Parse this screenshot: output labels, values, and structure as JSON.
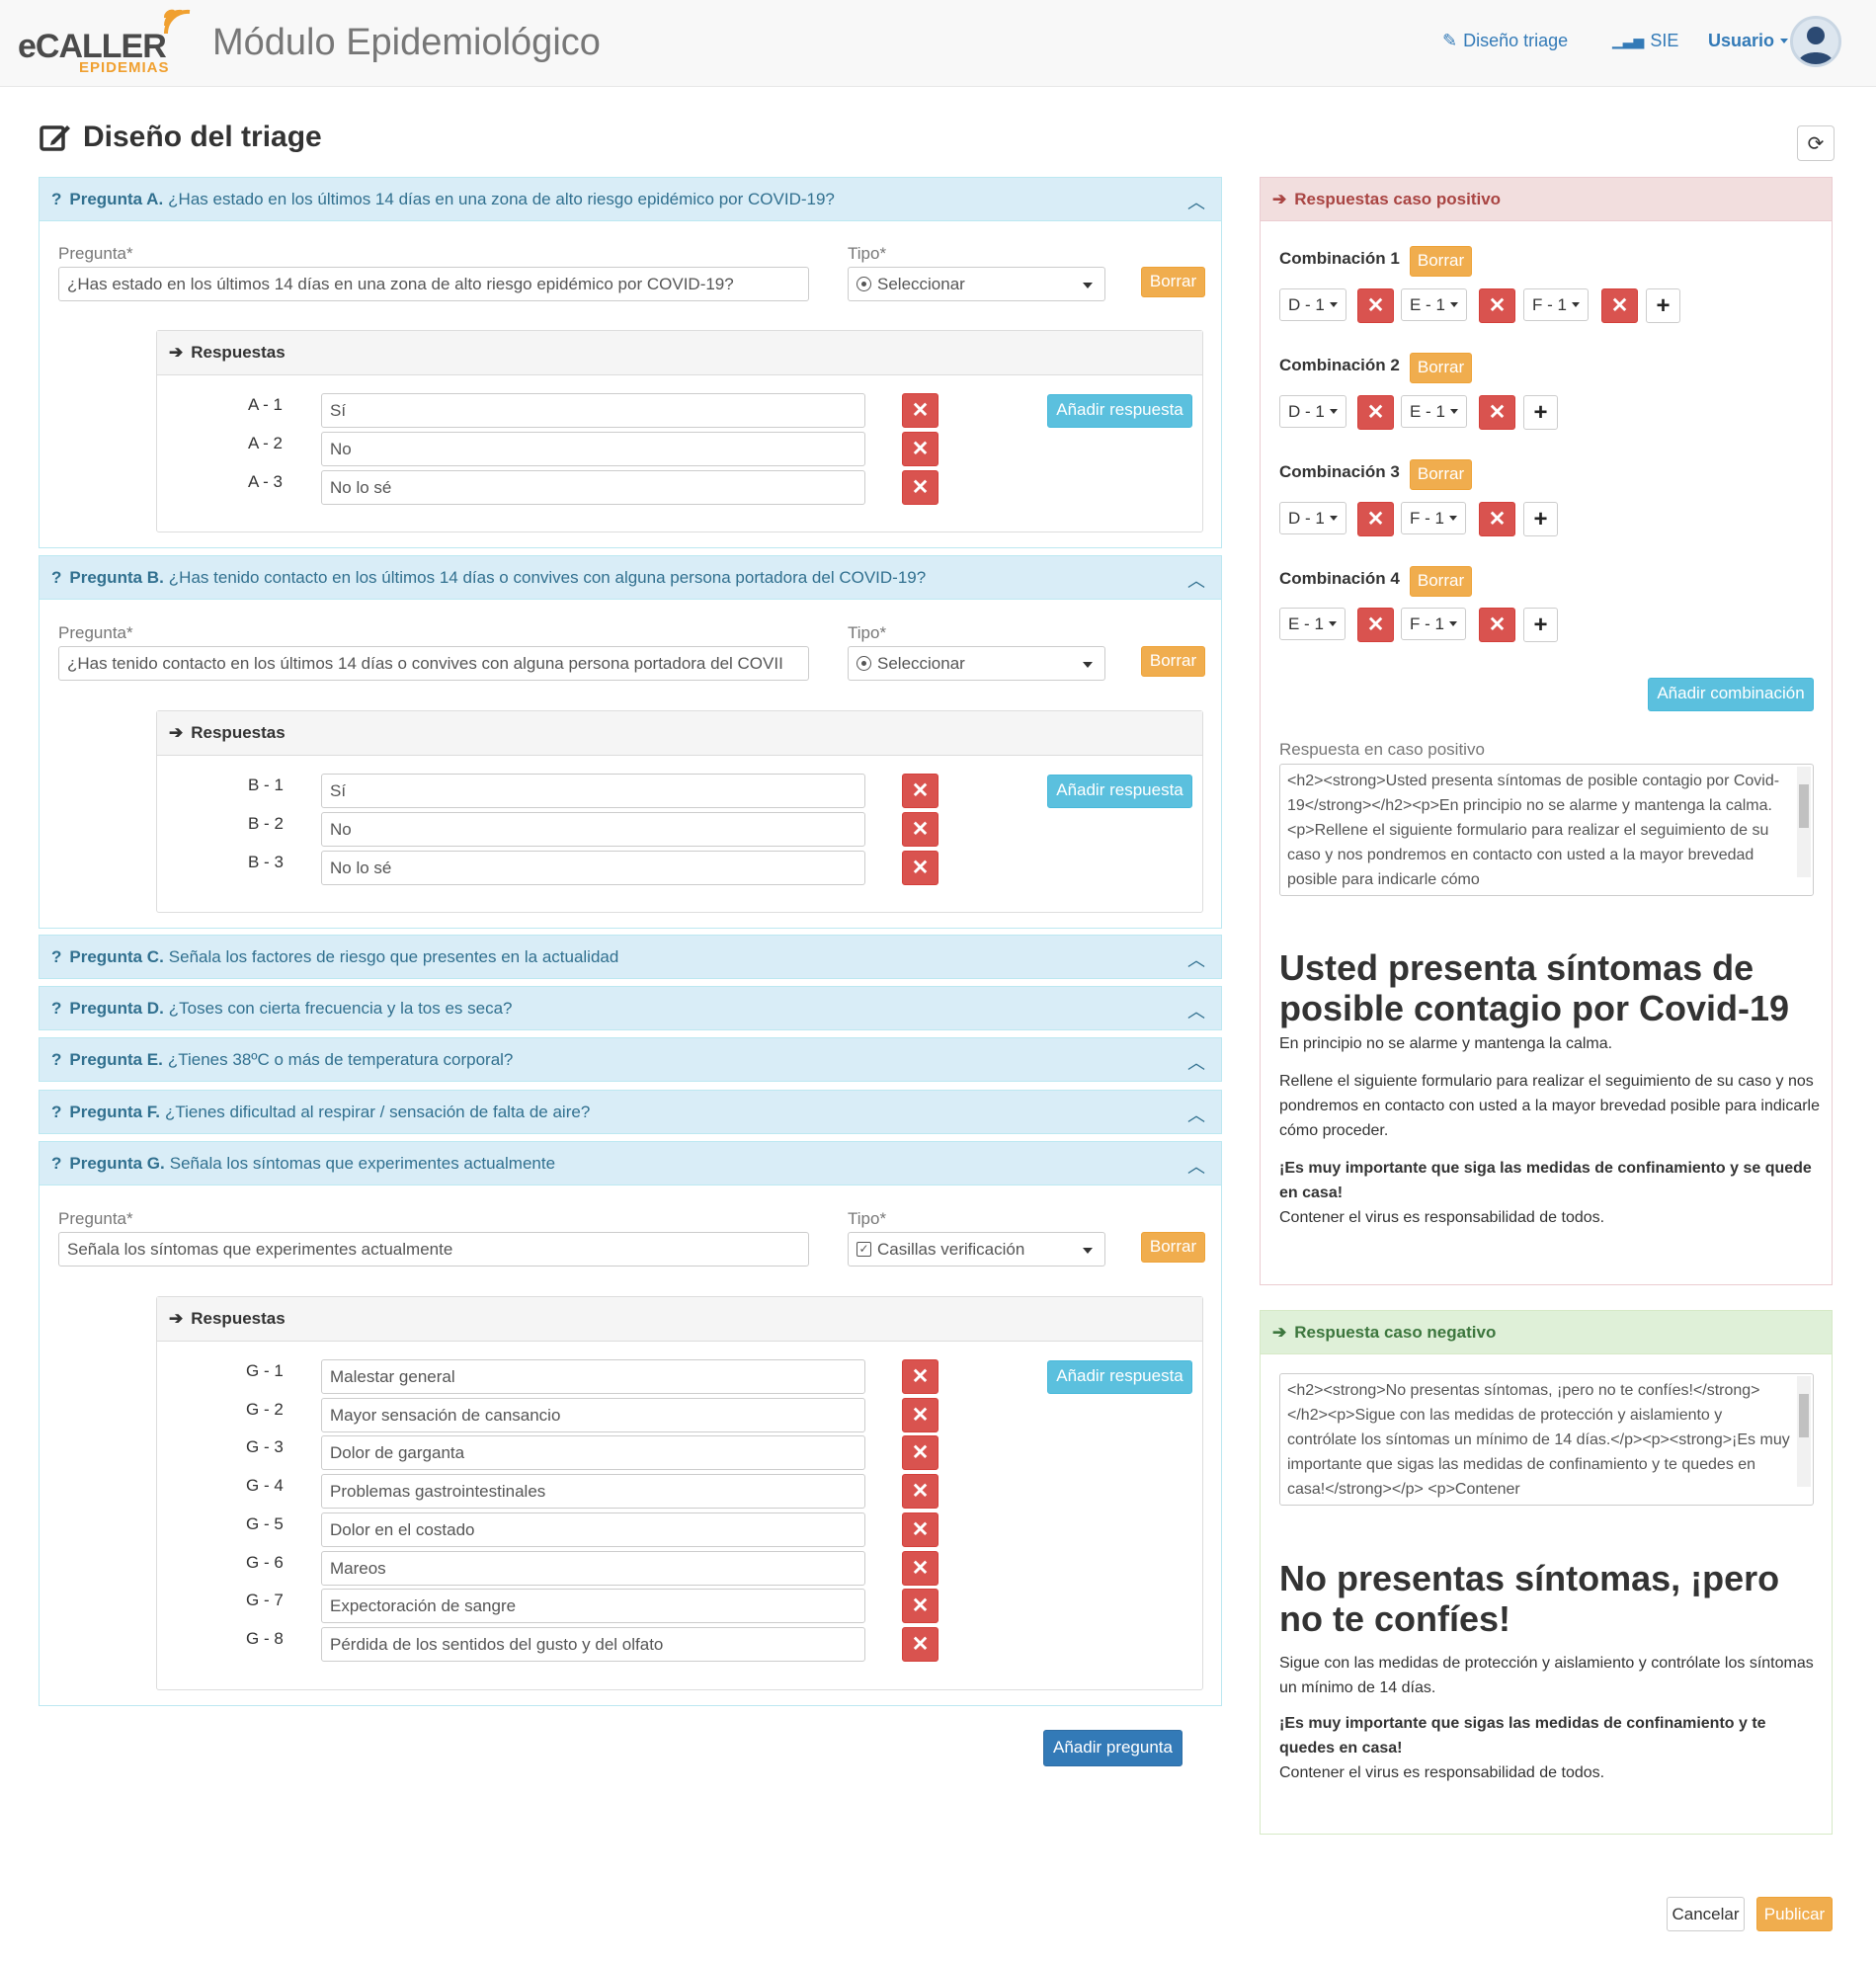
{
  "header": {
    "logo_text": "eCALLER",
    "logo_sub": "EPIDEMIAS",
    "app_title": "Módulo Epidemiológico",
    "nav": [
      {
        "label": "Diseño triage",
        "icon": "edit-icon"
      },
      {
        "label": "SIE",
        "icon": "bar-chart-icon"
      }
    ],
    "user_label": "Usuario"
  },
  "page": {
    "title": "Diseño del triage"
  },
  "questions": [
    {
      "letter": "Pregunta A.",
      "text": "¿Has estado en los últimos 14 días en una zona de alto riesgo epidémico por COVID-19?",
      "expanded": true,
      "field_label": "Pregunta*",
      "field_value": "¿Has estado en los últimos 14 días en una zona de alto riesgo epidémico por COVID-19?",
      "type_label": "Tipo*",
      "type_value": "Seleccionar",
      "type_icon": "radio-icon",
      "delete_label": "Borrar",
      "answers_title": "Respuestas",
      "add_answer": "Añadir respuesta",
      "answers": [
        {
          "code": "A - 1",
          "value": "Sí"
        },
        {
          "code": "A - 2",
          "value": "No"
        },
        {
          "code": "A - 3",
          "value": "No lo sé"
        }
      ]
    },
    {
      "letter": "Pregunta B.",
      "text": "¿Has tenido contacto en los últimos 14 días o convives con alguna persona portadora del COVID-19?",
      "expanded": true,
      "field_label": "Pregunta*",
      "field_value": "¿Has tenido contacto en los últimos 14 días o convives con alguna persona portadora del COVII",
      "type_label": "Tipo*",
      "type_value": "Seleccionar",
      "type_icon": "radio-icon",
      "delete_label": "Borrar",
      "answers_title": "Respuestas",
      "add_answer": "Añadir respuesta",
      "answers": [
        {
          "code": "B - 1",
          "value": "Sí"
        },
        {
          "code": "B - 2",
          "value": "No"
        },
        {
          "code": "B - 3",
          "value": "No lo sé"
        }
      ]
    },
    {
      "letter": "Pregunta C.",
      "text": "Señala los factores de riesgo que presentes en la actualidad",
      "expanded": false
    },
    {
      "letter": "Pregunta D.",
      "text": "¿Toses con cierta frecuencia y la tos es seca?",
      "expanded": false
    },
    {
      "letter": "Pregunta E.",
      "text": "¿Tienes 38ºC o más de temperatura corporal?",
      "expanded": false
    },
    {
      "letter": "Pregunta F.",
      "text": "¿Tienes dificultad al respirar / sensación de falta de aire?",
      "expanded": false
    },
    {
      "letter": "Pregunta G.",
      "text": "Señala los síntomas que experimentes actualmente",
      "expanded": true,
      "field_label": "Pregunta*",
      "field_value": "Señala los síntomas que experimentes actualmente",
      "type_label": "Tipo*",
      "type_value": "Casillas verificación",
      "type_icon": "checkbox-icon",
      "delete_label": "Borrar",
      "answers_title": "Respuestas",
      "add_answer": "Añadir respuesta",
      "answers": [
        {
          "code": "G - 1",
          "value": "Malestar general"
        },
        {
          "code": "G - 2",
          "value": "Mayor sensación de cansancio"
        },
        {
          "code": "G - 3",
          "value": "Dolor de garganta"
        },
        {
          "code": "G - 4",
          "value": "Problemas gastrointestinales"
        },
        {
          "code": "G - 5",
          "value": "Dolor en el costado"
        },
        {
          "code": "G - 6",
          "value": "Mareos"
        },
        {
          "code": "G - 7",
          "value": "Expectoración de sangre"
        },
        {
          "code": "G - 8",
          "value": "Pérdida de los sentidos del gusto y del olfato"
        }
      ]
    }
  ],
  "add_question": "Añadir pregunta",
  "positive": {
    "title": "Respuestas caso positivo",
    "combinations": [
      {
        "label": "Combinación 1",
        "delete": "Borrar",
        "items": [
          "D - 1",
          "E - 1",
          "F - 1"
        ]
      },
      {
        "label": "Combinación 2",
        "delete": "Borrar",
        "items": [
          "D - 1",
          "E - 1"
        ]
      },
      {
        "label": "Combinación 3",
        "delete": "Borrar",
        "items": [
          "D - 1",
          "F - 1"
        ]
      },
      {
        "label": "Combinación 4",
        "delete": "Borrar",
        "items": [
          "E - 1",
          "F - 1"
        ]
      }
    ],
    "add_combination": "Añadir combinación",
    "response_label": "Respuesta en caso positivo",
    "response_html": "<h2><strong>Usted presenta síntomas de posible contagio por Covid-19</strong></h2><p>En principio no se alarme y mantenga la calma.<p>Rellene el siguiente formulario para realizar el seguimiento de su caso y nos pondremos en contacto con usted a la mayor brevedad posible para indicarle cómo",
    "preview_title": "Usted presenta síntomas de posible contagio por Covid-19",
    "preview_p1": "En principio no se alarme y mantenga la calma.",
    "preview_p2": "Rellene el siguiente formulario para realizar el seguimiento de su caso y nos pondremos en contacto con usted a la mayor brevedad posible para indicarle cómo proceder.",
    "preview_p3": "¡Es muy importante que siga las medidas de confinamiento y se quede en casa!",
    "preview_p4": "Contener el virus es responsabilidad de todos."
  },
  "negative": {
    "title": "Respuesta caso negativo",
    "response_html": "<h2><strong>No presentas síntomas, ¡pero no te confíes!</strong></h2><p>Sigue con las medidas de protección y aislamiento y contrólate los síntomas un mínimo de 14 días.</p><p><strong>¡Es muy importante que sigas las medidas de confinamiento y te quedes en casa!</strong></p> <p>Contener",
    "preview_title": "No presentas síntomas, ¡pero no te confíes!",
    "preview_p1": "Sigue con las medidas de protección y aislamiento y contrólate los síntomas un mínimo de 14 días.",
    "preview_p2": "¡Es muy importante que sigas las medidas de confinamiento y te quedes en casa!",
    "preview_p3": "Contener el virus es responsabilidad de todos."
  },
  "footer": {
    "cancel": "Cancelar",
    "publish": "Publicar"
  },
  "colors": {
    "info_bg": "#d9edf7",
    "info_text": "#31708f",
    "danger_bg": "#f2dede",
    "danger_text": "#a94442",
    "success_bg": "#dff0d8",
    "success_text": "#3c763d",
    "warning": "#f0ad4e",
    "delete": "#d9534f",
    "primary": "#337ab7"
  }
}
